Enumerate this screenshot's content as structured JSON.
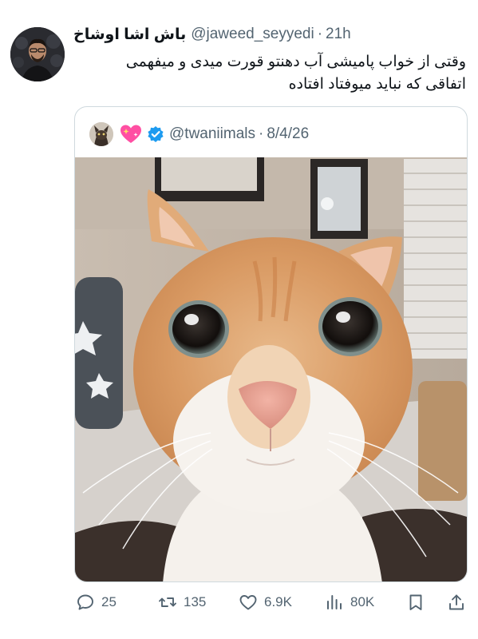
{
  "tweet": {
    "display_name": "باش اشا اوشاخ",
    "handle": "@jaweed_seyyedi",
    "separator": "·",
    "time": "21h",
    "text_lines": [
      "وقتی از خواب پامیشی آب دهنتو قورت میدی و میفهمی",
      "اتفاقی که نباید میوفتاد افتاده"
    ]
  },
  "quote": {
    "heart_icon": "sparkling-heart-icon",
    "verified_icon": "verified-badge-icon",
    "handle": "@twaniimals",
    "separator": "·",
    "date": "8/4/26",
    "photo": "close-up-wide-eyed-orange-cat"
  },
  "actions": {
    "reply_count": "25",
    "retweet_count": "135",
    "like_count": "6.9K",
    "views_count": "80K"
  },
  "colors": {
    "text": "#0f1419",
    "secondary": "#536471",
    "border": "#cfd9de",
    "verified": "#1d9bf0",
    "heart": "#ff4fa3"
  }
}
